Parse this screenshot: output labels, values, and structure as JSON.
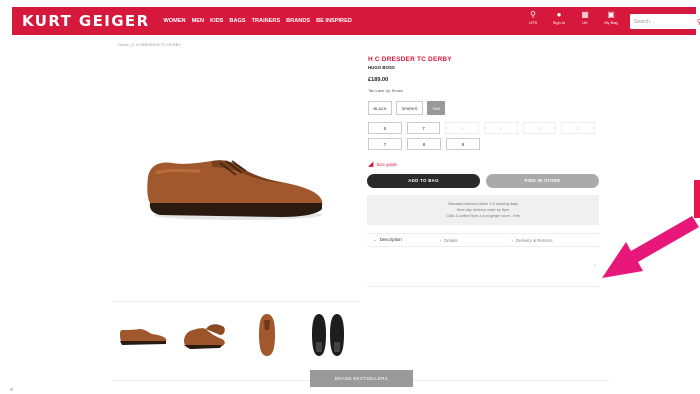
{
  "header": {
    "logo": "KURT GEIGER",
    "nav": [
      "WOMEN",
      "MEN",
      "KIDS",
      "BAGS",
      "TRAINERS",
      "BRANDS",
      "BE INSPIRED"
    ],
    "icons": [
      {
        "name": "location-icon",
        "glyph": "⚲",
        "label": "UTS"
      },
      {
        "name": "user-icon",
        "glyph": "●",
        "label": "Sign In"
      },
      {
        "name": "flag-icon",
        "glyph": "▦",
        "label": "UK"
      },
      {
        "name": "bag-icon",
        "glyph": "▣",
        "label": "My Bag"
      }
    ],
    "search_placeholder": "Search...",
    "accent": "#d5183c"
  },
  "breadcrumb": "Home | C H GRESDER TC DERBY",
  "product": {
    "title": "H C DRESDER TC DERBY",
    "brand": "HUGO BOSS",
    "price": "£189.00",
    "type": "Tan Lace Up Shoes",
    "colors": [
      "BLACK",
      "SPARKS",
      "TAN"
    ],
    "selected_color": "TAN",
    "sizes_row1": [
      "6",
      "7",
      "8",
      "9",
      "10",
      "11"
    ],
    "sizes_row2": [
      "7",
      "8",
      "9"
    ],
    "size_guide": "Size guide",
    "add_to_bag": "ADD TO BAG",
    "find_in_store": "FIND IN STORE",
    "delivery_lines": [
      "Standard delivery within 3-5 working days",
      "Next day delivery order by 8pm",
      "Click & collect from a kurt geiger store - free"
    ],
    "tabs": [
      "Description",
      "Details",
      "Delivery & Returns"
    ]
  },
  "brand_button": "BRAND BESTSELLERS"
}
